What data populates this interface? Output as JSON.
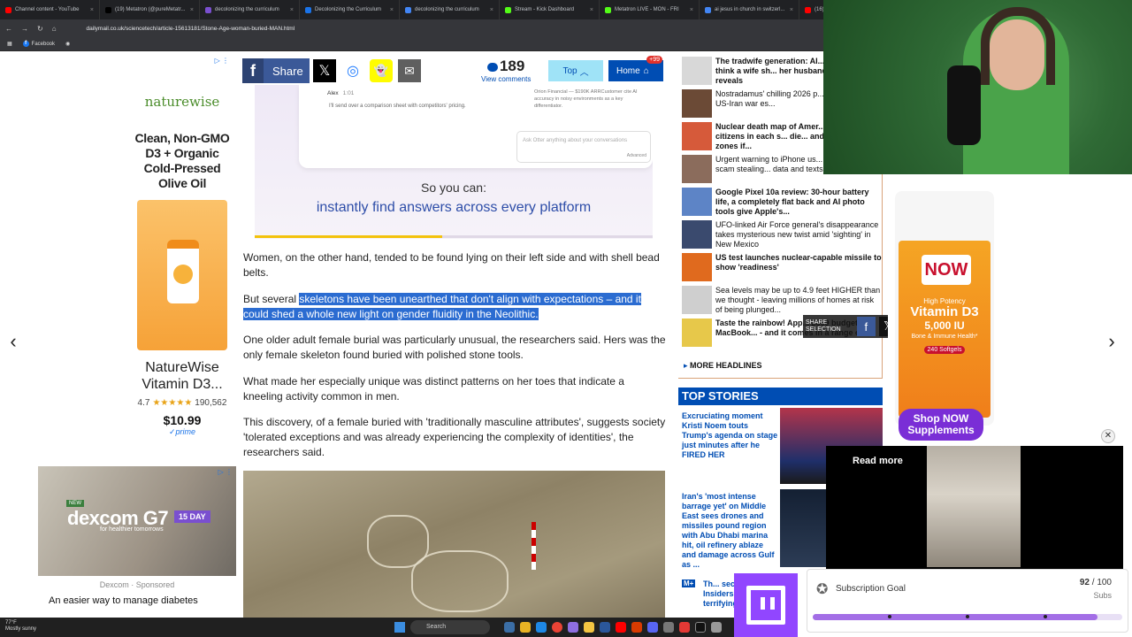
{
  "browser": {
    "tabs": [
      {
        "title": "Channel content - YouTube",
        "color": "#ff0000"
      },
      {
        "title": "(19) Metatron (@pureMetatr...",
        "color": "#000000"
      },
      {
        "title": "decolonizing the curriculum",
        "color": "#7a4fcf"
      },
      {
        "title": "Decolonizing the Curriculum",
        "color": "#1a73e8"
      },
      {
        "title": "decolonizing the curriculum",
        "color": "#4285f4"
      },
      {
        "title": "Stream - Kick Dashboard",
        "color": "#53fc18"
      },
      {
        "title": "Metatron LIVE - MON - FRI",
        "color": "#53fc18"
      },
      {
        "title": "ai jesus in church in switzerl...",
        "color": "#4285f4"
      },
      {
        "title": "(16) The...",
        "color": "#ff0000"
      }
    ],
    "url": "dailymail.co.uk/sciencetech/article-15613181/Stone-Age-woman-buried-MAN.html",
    "bookmark": "Facebook"
  },
  "left_ad": {
    "brand": "naturewise",
    "headline": "Clean, Non-GMO D3 + Organic Cold-Pressed Olive Oil",
    "product": "NatureWise Vitamin D3...",
    "rating": "4.7",
    "reviews": "190,562",
    "price": "$10.99",
    "prime": "✓prime",
    "ad_marker": "▷ ⋮"
  },
  "dex_ad": {
    "badge_new": "NEW",
    "logo": "dexcom G7",
    "day_badge": "15 DAY",
    "tagline": "for healthier tomorrows",
    "sponsor": "Dexcom · Sponsored",
    "copy": "An easier way to manage diabetes",
    "ad_marker": "▷ ⋮"
  },
  "share_bar": {
    "share_label": "Share",
    "comment_count": "189",
    "view_comments": "View comments",
    "top_label": "Top",
    "home_label": "Home",
    "home_badge": "+99"
  },
  "video": {
    "sender": "Alex",
    "time": "1:01",
    "message": "I'll send over a comparison sheet with competitors' pricing.",
    "side_note": "Orion Financial — $190K ARRCustomer cite AI accuracy in noisy environments as a key differentiator.",
    "ask_placeholder": "Ask Otter anything about your conversations",
    "ask_advanced": "Advanced",
    "subtitle_1": "So you can:",
    "subtitle_2": "instantly find answers across every platform",
    "progress": 0.47
  },
  "article": {
    "p1": "Women, on the other hand, tended to be found lying on their left side and with shell bead belts.",
    "p2_before": "But several ",
    "p2_highlight": "skeletons have been unearthed that don't align with expectations – and it could shed a whole new light on gender fluidity in the Neolithic.",
    "p3": "One older adult female burial was particularly unusual, the researchers said. Hers was the only female skeleton found buried with polished stone tools.",
    "p4": "What made her especially unique was distinct patterns on her toes that indicate a kneeling activity common in men.",
    "p5": "This discovery, of a female buried with 'traditionally masculine attributes', suggests society 'tolerated exceptions and was already experiencing the complexity of identities', the researchers said."
  },
  "sidebar": {
    "items": [
      {
        "text": "The tradwife generation: Al... of Gen Z men think a wife sh... her husband, study reveals",
        "bold": true,
        "thumb": "#d8d8d8"
      },
      {
        "text": "Nostradamus' chilling 2026 p... resurfaces as US-Iran war es...",
        "bold": false,
        "thumb": "#6b4a36"
      },
      {
        "text": "Nuclear death map of Amer... how FAST citizens in each s... die... and rare safe zones if...",
        "bold": true,
        "thumb": "#d65a3a"
      },
      {
        "text": "Urgent warning to iPhone us... 'sophisticated' scam stealing... data and texts: Act NOW",
        "bold": false,
        "thumb": "#8b6c5c"
      },
      {
        "text": "Google Pixel 10a review: 30-hour battery life, a completely flat back and AI photo tools give Apple's...",
        "bold": true,
        "thumb": "#5d84c6"
      },
      {
        "text": "UFO-linked Air Force general's disappearance takes mysterious new twist amid 'sighting' in New Mexico",
        "bold": false,
        "thumb": "#3a4a6e"
      },
      {
        "text": "US test launches nuclear-capable missile to show 'readiness'",
        "bold": true,
        "thumb": "#e06a1e"
      },
      {
        "text": "Sea levels may be up to 4.9 feet HIGHER than we thought - leaving millions of homes at risk of being plunged...",
        "bold": false,
        "thumb": "#cfcfcf"
      },
      {
        "text": "Taste the rainbow! App... £599 budget MacBook... - and it comes in a range of...",
        "bold": true,
        "thumb": "#e7c84a"
      }
    ],
    "more": "MORE HEADLINES"
  },
  "share_selection": {
    "label": "SHARE SELECTION"
  },
  "top_stories": {
    "title": "TOP STORIES",
    "items": [
      "Excruciating moment Kristi Noem touts Trump's agenda on stage just minutes after he FIRED HER",
      "Iran's 'most intense barrage yet' on Middle East sees drones and missiles pound region with Abu Dhabi marina hit, oil refinery ablaze and damage across Gulf as ...",
      "Th... secret pan... Insiders let... terrifying in..."
    ],
    "plus_badge": "M+"
  },
  "right_ad": {
    "brand": "NOW",
    "potency": "High Potency",
    "product": "Vitamin D3",
    "dose": "5,000 IU",
    "benefit": "Bone & Immune Health*",
    "count": "240 Softgels",
    "cta": "Shop NOW Supplements"
  },
  "stream": {
    "read_more": "Read more",
    "goal_title": "Subscription Goal",
    "goal_current": "92",
    "goal_total": "100",
    "goal_unit": "Subs"
  },
  "taskbar": {
    "weather_temp": "77°F",
    "weather_desc": "Mostly sunny",
    "search": "Search"
  }
}
